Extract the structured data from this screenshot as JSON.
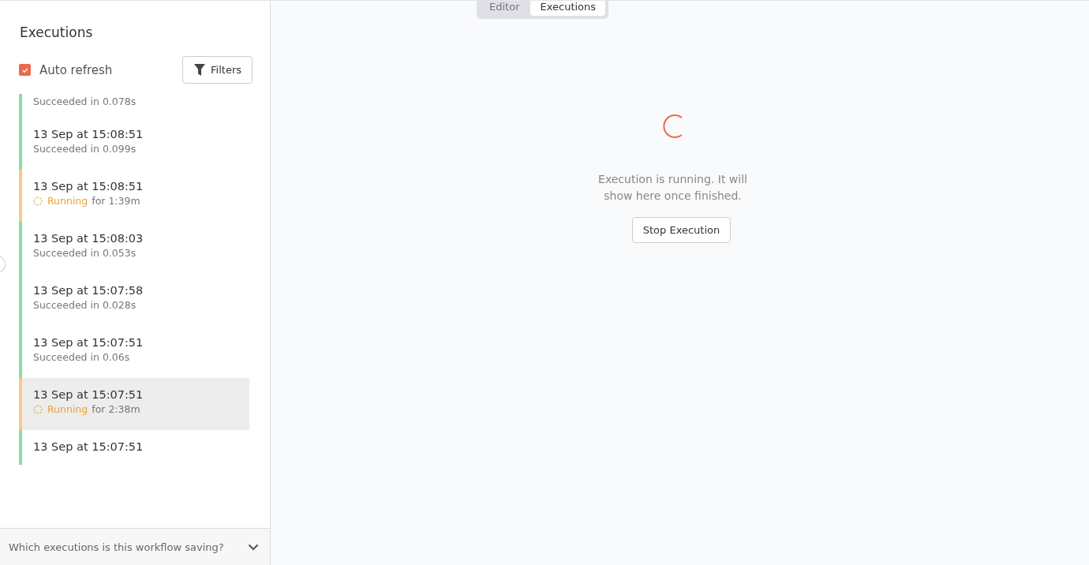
{
  "tabs": [
    {
      "label": "Editor",
      "selected": false
    },
    {
      "label": "Executions",
      "selected": true
    }
  ],
  "sidebar": {
    "title": "Executions",
    "auto_refresh": {
      "label": "Auto refresh",
      "checked": true
    },
    "filters_button": "Filters",
    "executions": [
      {
        "kind": "success",
        "status": "Succeeded in 0.078s",
        "selected": false
      },
      {
        "kind": "success",
        "date": "13 Sep at 15:08:51",
        "status": "Succeeded in 0.099s",
        "selected": false
      },
      {
        "kind": "running",
        "date": "13 Sep at 15:08:51",
        "status": "Running",
        "duration": "for 1:39m",
        "selected": false
      },
      {
        "kind": "success",
        "date": "13 Sep at 15:08:03",
        "status": "Succeeded in 0.053s",
        "selected": false
      },
      {
        "kind": "success",
        "date": "13 Sep at 15:07:58",
        "status": "Succeeded in 0.028s",
        "selected": false
      },
      {
        "kind": "success",
        "date": "13 Sep at 15:07:51",
        "status": "Succeeded in 0.06s",
        "selected": false
      },
      {
        "kind": "running",
        "date": "13 Sep at 15:07:51",
        "status": "Running",
        "duration": "for 2:38m",
        "selected": true
      },
      {
        "kind": "success",
        "date": "13 Sep at 15:07:51",
        "selected": false
      }
    ],
    "footer": "Which executions is this workflow saving?"
  },
  "main": {
    "message": "Execution is running. It will show here once finished.",
    "stop_button": "Stop Execution"
  }
}
